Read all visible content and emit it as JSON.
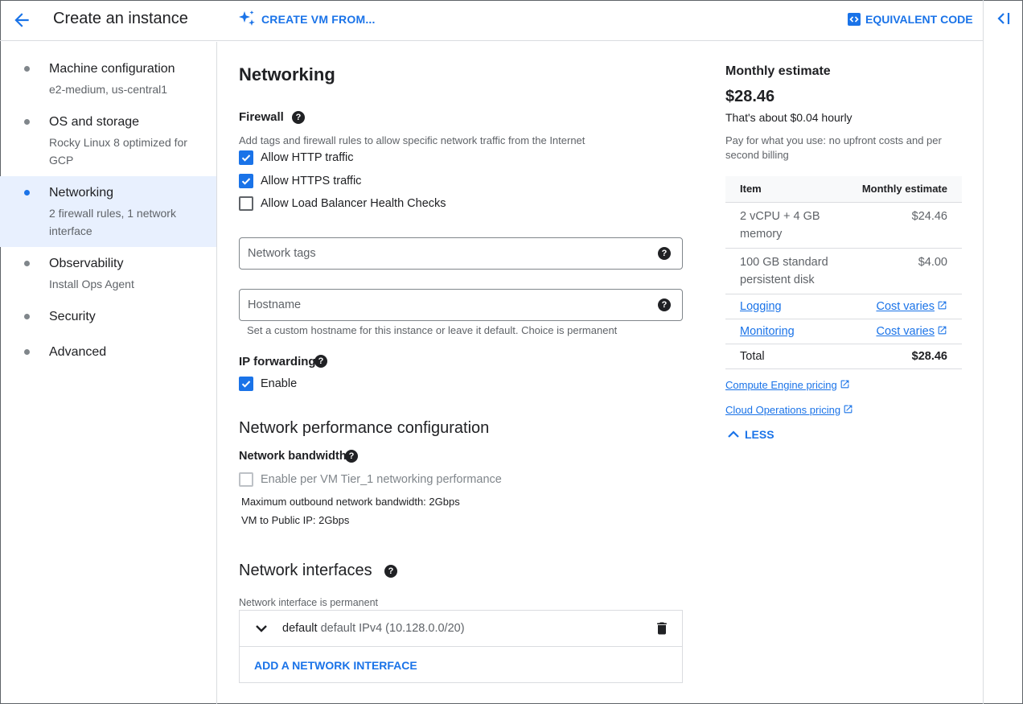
{
  "header": {
    "title": "Create an instance",
    "create_from_label": "CREATE VM FROM...",
    "equivalent_code_label": "EQUIVALENT CODE"
  },
  "sidebar": {
    "items": [
      {
        "label": "Machine configuration",
        "sub": "e2-medium, us-central1"
      },
      {
        "label": "OS and storage",
        "sub": "Rocky Linux 8 optimized for GCP"
      },
      {
        "label": "Networking",
        "sub": "2 firewall rules, 1 network interface"
      },
      {
        "label": "Observability",
        "sub": "Install Ops Agent"
      },
      {
        "label": "Security",
        "sub": ""
      },
      {
        "label": "Advanced",
        "sub": ""
      }
    ],
    "active_index": 2
  },
  "main": {
    "title": "Networking",
    "firewall": {
      "heading": "Firewall",
      "description": "Add tags and firewall rules to allow specific network traffic from the Internet",
      "options": [
        {
          "label": "Allow HTTP traffic",
          "checked": true
        },
        {
          "label": "Allow HTTPS traffic",
          "checked": true
        },
        {
          "label": "Allow Load Balancer Health Checks",
          "checked": false
        }
      ]
    },
    "network_tags": {
      "placeholder": "Network tags",
      "value": ""
    },
    "hostname": {
      "placeholder": "Hostname",
      "value": "",
      "hint": "Set a custom hostname for this instance or leave it default. Choice is permanent"
    },
    "ip_forwarding": {
      "heading": "IP forwarding",
      "enable_label": "Enable",
      "checked": true
    },
    "perf": {
      "heading": "Network performance configuration",
      "bandwidth_heading": "Network bandwidth",
      "tier1_label": "Enable per VM Tier_1 networking performance",
      "tier1_checked": false,
      "max_outbound": "Maximum outbound network bandwidth: 2Gbps",
      "vm_to_public": "VM to Public IP: 2Gbps"
    },
    "interfaces": {
      "heading": "Network interfaces",
      "note": "Network interface is permanent",
      "item_name": "default",
      "item_detail": "default IPv4 (10.128.0.0/20)",
      "add_label": "ADD A NETWORK INTERFACE"
    }
  },
  "estimate": {
    "title": "Monthly estimate",
    "amount": "$28.46",
    "hourly": "That's about $0.04 hourly",
    "pay_note": "Pay for what you use: no upfront costs and per second billing",
    "col_item": "Item",
    "col_estimate": "Monthly estimate",
    "rows": [
      {
        "item": "2 vCPU + 4 GB memory",
        "cost": "$24.46"
      },
      {
        "item": "100 GB standard persistent disk",
        "cost": "$4.00"
      },
      {
        "item": "Logging",
        "cost": "Cost varies"
      },
      {
        "item": "Monitoring",
        "cost": "Cost varies"
      }
    ],
    "total_label": "Total",
    "total_value": "$28.46",
    "link_compute": "Compute Engine pricing",
    "link_cloudops": "Cloud Operations pricing",
    "less_label": "LESS"
  },
  "colors": {
    "accent": "#1a73e8",
    "active_bg": "#e8f0fe",
    "text": "#202124",
    "muted": "#5f6368"
  }
}
